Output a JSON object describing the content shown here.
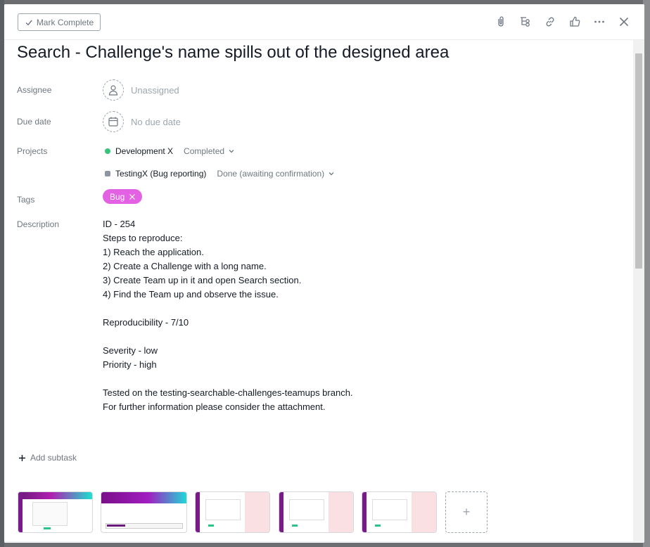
{
  "toolbar": {
    "mark_complete_label": "Mark Complete",
    "icons": [
      "attachment-icon",
      "subtask-icon",
      "link-icon",
      "like-icon",
      "more-icon",
      "close-icon"
    ]
  },
  "task": {
    "title": "Search - Challenge's name spills out of the designed area",
    "assignee_label": "Assignee",
    "assignee_value": "Unassigned",
    "due_date_label": "Due date",
    "due_date_value": "No due date",
    "projects_label": "Projects",
    "projects": [
      {
        "name": "Development X",
        "status": "Completed",
        "color": "#37c47a"
      },
      {
        "name": "TestingX (Bug reporting)",
        "status": "Done (awaiting confirmation)",
        "color": "#8d96a0"
      }
    ],
    "tags_label": "Tags",
    "tag": {
      "name": "Bug",
      "color": "#e362e3"
    },
    "description_label": "Description",
    "description": "ID - 254\nSteps to reproduce:\n1) Reach the application.\n2) Create a Challenge with a long name.\n3) Create Team up in it and open Search section.\n4) Find the Team up and observe the issue.\n\nReproducibility - 7/10\n\nSeverity - low\nPriority - high\n\nTested on the testing-searchable-challenges-teamups branch.\nFor further information please consider the attachment.",
    "add_subtask_label": "Add subtask",
    "attachments_count": 5,
    "add_attachment_label": "+"
  }
}
